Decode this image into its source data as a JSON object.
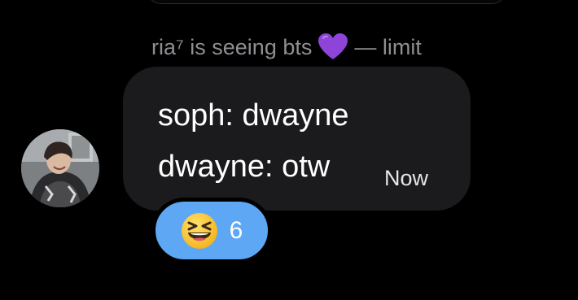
{
  "message": {
    "sender_line": "ria⁷ is seeing bts",
    "sender_suffix": "— limit",
    "sender_emoji": "purple-heart-icon",
    "lines": [
      "soph: dwayne",
      "dwayne: otw"
    ],
    "timestamp": "Now",
    "avatar_icon": "avatar-photo",
    "reaction": {
      "icon": "grinning-squinting-face-icon",
      "count": "6"
    }
  },
  "colors": {
    "background": "#000000",
    "bubble": "#1b1b1d",
    "reaction_pill": "#5ea7f4",
    "secondary_text": "#8e8e93",
    "heart": "#8e44d8"
  }
}
